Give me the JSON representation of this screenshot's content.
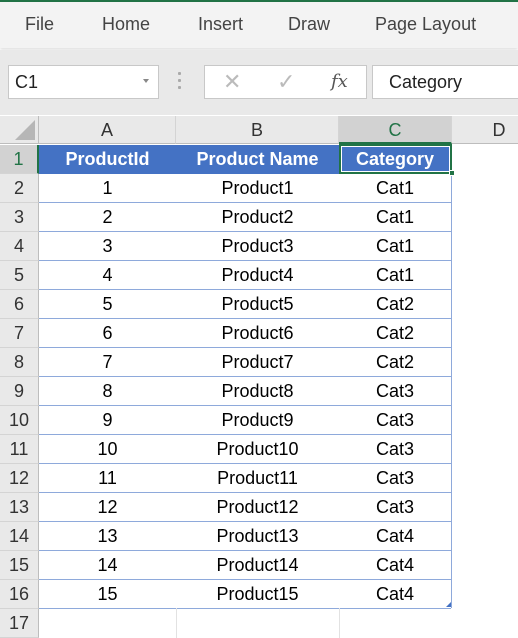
{
  "ribbon": {
    "tabs": [
      "File",
      "Home",
      "Insert",
      "Draw",
      "Page Layout"
    ]
  },
  "formula_bar": {
    "name_box": "C1",
    "cancel_icon": "✕",
    "enter_icon": "✓",
    "fx_label": "fx",
    "formula_value": "Category"
  },
  "sheet": {
    "columns": [
      "A",
      "B",
      "C",
      "D"
    ],
    "selected_cell": "C1",
    "row_numbers": [
      "1",
      "2",
      "3",
      "4",
      "5",
      "6",
      "7",
      "8",
      "9",
      "10",
      "11",
      "12",
      "13",
      "14",
      "15",
      "16",
      "17"
    ],
    "header": [
      "ProductId",
      "Product Name",
      "Category"
    ],
    "rows": [
      [
        "1",
        "Product1",
        "Cat1"
      ],
      [
        "2",
        "Product2",
        "Cat1"
      ],
      [
        "3",
        "Product3",
        "Cat1"
      ],
      [
        "4",
        "Product4",
        "Cat1"
      ],
      [
        "5",
        "Product5",
        "Cat2"
      ],
      [
        "6",
        "Product6",
        "Cat2"
      ],
      [
        "7",
        "Product7",
        "Cat2"
      ],
      [
        "8",
        "Product8",
        "Cat3"
      ],
      [
        "9",
        "Product9",
        "Cat3"
      ],
      [
        "10",
        "Product10",
        "Cat3"
      ],
      [
        "11",
        "Product11",
        "Cat3"
      ],
      [
        "12",
        "Product12",
        "Cat3"
      ],
      [
        "13",
        "Product13",
        "Cat4"
      ],
      [
        "14",
        "Product14",
        "Cat4"
      ],
      [
        "15",
        "Product15",
        "Cat4"
      ]
    ]
  },
  "colors": {
    "accent_green": "#217346",
    "table_header_blue": "#4472c4",
    "table_border_blue": "#8ea9db"
  }
}
